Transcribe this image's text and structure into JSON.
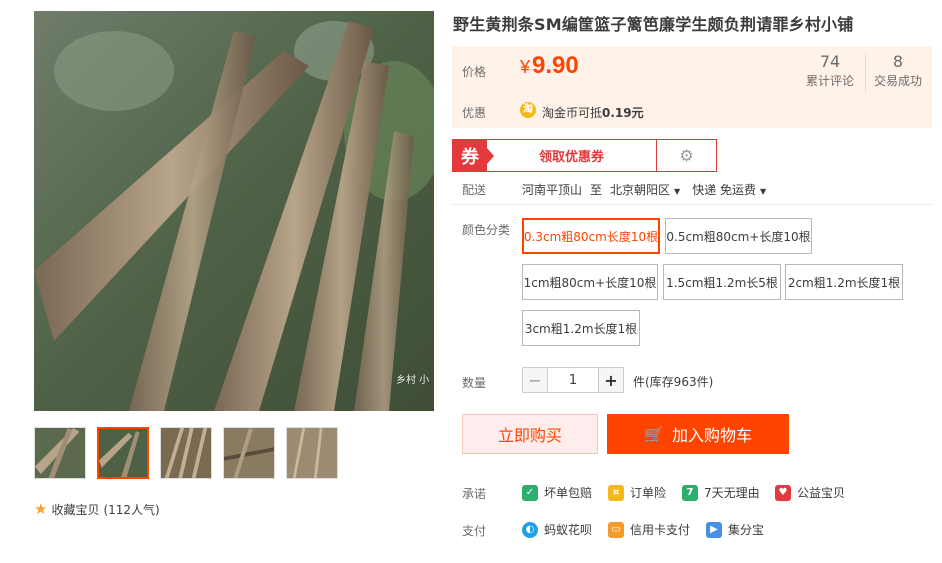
{
  "title": "野生黄荆条SM编筐篮子篱笆廉学生颇负荆请罪乡村小铺",
  "price": {
    "label": "价格",
    "currency": "¥",
    "value": "9.90"
  },
  "stats": [
    {
      "num": "74",
      "label": "累计评论"
    },
    {
      "num": "8",
      "label": "交易成功"
    }
  ],
  "promo": {
    "label": "优惠",
    "icon_text": "淘",
    "text_prefix": "淘金币可抵",
    "text_amount": "0.19元"
  },
  "coupon": {
    "tag": "券",
    "text": "领取优惠券"
  },
  "shipping": {
    "label": "配送",
    "from": "河南平顶山",
    "to_word": "至",
    "dest": "北京朝阳区",
    "method": "快递 免运费"
  },
  "sku": {
    "label": "颜色分类",
    "options": [
      "0.3cm粗80cm长度10根",
      "0.5cm粗80cm+长度10根",
      "1cm粗80cm+长度10根",
      "1.5cm粗1.2m长5根",
      "2cm粗1.2m长度1根",
      "3cm粗1.2m长度1根"
    ],
    "selected_index": 0
  },
  "quantity": {
    "label": "数量",
    "value": "1",
    "minus": "−",
    "plus": "+",
    "stock": "件(库存963件)"
  },
  "buttons": {
    "buy": "立即购买",
    "cart": "加入购物车"
  },
  "promise": {
    "label": "承诺",
    "items": [
      {
        "text": "坏单包赔",
        "icon": "shield-icon",
        "color": "#2dad6f"
      },
      {
        "text": "订单险",
        "icon": "insurance-icon",
        "color": "#f5b81c"
      },
      {
        "text": "7天无理由",
        "icon": "seven-day-icon",
        "color": "#2dad6f"
      },
      {
        "text": "公益宝贝",
        "icon": "charity-icon",
        "color": "#e4393c"
      }
    ]
  },
  "payment": {
    "label": "支付",
    "items": [
      {
        "text": "蚂蚁花呗",
        "icon": "huabei-icon",
        "color": "#1e9fe8"
      },
      {
        "text": "信用卡支付",
        "icon": "credit-card-icon",
        "color": "#f39a2b"
      },
      {
        "text": "集分宝",
        "icon": "jifenbao-icon",
        "color": "#4a90e2"
      }
    ]
  },
  "favorite": {
    "text": "收藏宝贝",
    "count": "(112人气)"
  },
  "image_watermark": "乡村 小"
}
